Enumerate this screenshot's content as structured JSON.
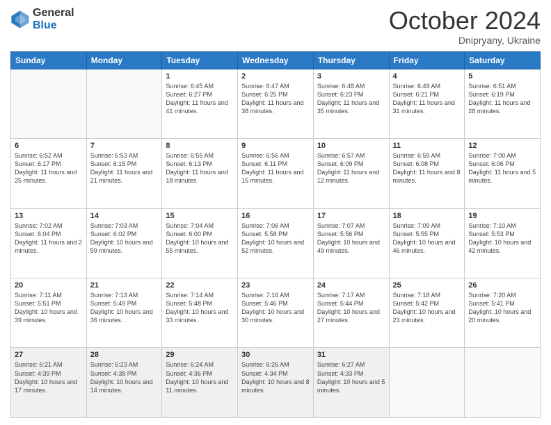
{
  "header": {
    "logo_general": "General",
    "logo_blue": "Blue",
    "month_year": "October 2024",
    "location": "Dnipryany, Ukraine"
  },
  "days_of_week": [
    "Sunday",
    "Monday",
    "Tuesday",
    "Wednesday",
    "Thursday",
    "Friday",
    "Saturday"
  ],
  "weeks": [
    [
      {
        "day": "",
        "sunrise": "",
        "sunset": "",
        "daylight": ""
      },
      {
        "day": "",
        "sunrise": "",
        "sunset": "",
        "daylight": ""
      },
      {
        "day": "1",
        "sunrise": "Sunrise: 6:45 AM",
        "sunset": "Sunset: 6:27 PM",
        "daylight": "Daylight: 11 hours and 41 minutes."
      },
      {
        "day": "2",
        "sunrise": "Sunrise: 6:47 AM",
        "sunset": "Sunset: 6:25 PM",
        "daylight": "Daylight: 11 hours and 38 minutes."
      },
      {
        "day": "3",
        "sunrise": "Sunrise: 6:48 AM",
        "sunset": "Sunset: 6:23 PM",
        "daylight": "Daylight: 11 hours and 35 minutes."
      },
      {
        "day": "4",
        "sunrise": "Sunrise: 6:49 AM",
        "sunset": "Sunset: 6:21 PM",
        "daylight": "Daylight: 11 hours and 31 minutes."
      },
      {
        "day": "5",
        "sunrise": "Sunrise: 6:51 AM",
        "sunset": "Sunset: 6:19 PM",
        "daylight": "Daylight: 11 hours and 28 minutes."
      }
    ],
    [
      {
        "day": "6",
        "sunrise": "Sunrise: 6:52 AM",
        "sunset": "Sunset: 6:17 PM",
        "daylight": "Daylight: 11 hours and 25 minutes."
      },
      {
        "day": "7",
        "sunrise": "Sunrise: 6:53 AM",
        "sunset": "Sunset: 6:15 PM",
        "daylight": "Daylight: 11 hours and 21 minutes."
      },
      {
        "day": "8",
        "sunrise": "Sunrise: 6:55 AM",
        "sunset": "Sunset: 6:13 PM",
        "daylight": "Daylight: 11 hours and 18 minutes."
      },
      {
        "day": "9",
        "sunrise": "Sunrise: 6:56 AM",
        "sunset": "Sunset: 6:11 PM",
        "daylight": "Daylight: 11 hours and 15 minutes."
      },
      {
        "day": "10",
        "sunrise": "Sunrise: 6:57 AM",
        "sunset": "Sunset: 6:09 PM",
        "daylight": "Daylight: 11 hours and 12 minutes."
      },
      {
        "day": "11",
        "sunrise": "Sunrise: 6:59 AM",
        "sunset": "Sunset: 6:08 PM",
        "daylight": "Daylight: 11 hours and 8 minutes."
      },
      {
        "day": "12",
        "sunrise": "Sunrise: 7:00 AM",
        "sunset": "Sunset: 6:06 PM",
        "daylight": "Daylight: 11 hours and 5 minutes."
      }
    ],
    [
      {
        "day": "13",
        "sunrise": "Sunrise: 7:02 AM",
        "sunset": "Sunset: 6:04 PM",
        "daylight": "Daylight: 11 hours and 2 minutes."
      },
      {
        "day": "14",
        "sunrise": "Sunrise: 7:03 AM",
        "sunset": "Sunset: 6:02 PM",
        "daylight": "Daylight: 10 hours and 59 minutes."
      },
      {
        "day": "15",
        "sunrise": "Sunrise: 7:04 AM",
        "sunset": "Sunset: 6:00 PM",
        "daylight": "Daylight: 10 hours and 55 minutes."
      },
      {
        "day": "16",
        "sunrise": "Sunrise: 7:06 AM",
        "sunset": "Sunset: 5:58 PM",
        "daylight": "Daylight: 10 hours and 52 minutes."
      },
      {
        "day": "17",
        "sunrise": "Sunrise: 7:07 AM",
        "sunset": "Sunset: 5:56 PM",
        "daylight": "Daylight: 10 hours and 49 minutes."
      },
      {
        "day": "18",
        "sunrise": "Sunrise: 7:09 AM",
        "sunset": "Sunset: 5:55 PM",
        "daylight": "Daylight: 10 hours and 46 minutes."
      },
      {
        "day": "19",
        "sunrise": "Sunrise: 7:10 AM",
        "sunset": "Sunset: 5:53 PM",
        "daylight": "Daylight: 10 hours and 42 minutes."
      }
    ],
    [
      {
        "day": "20",
        "sunrise": "Sunrise: 7:11 AM",
        "sunset": "Sunset: 5:51 PM",
        "daylight": "Daylight: 10 hours and 39 minutes."
      },
      {
        "day": "21",
        "sunrise": "Sunrise: 7:13 AM",
        "sunset": "Sunset: 5:49 PM",
        "daylight": "Daylight: 10 hours and 36 minutes."
      },
      {
        "day": "22",
        "sunrise": "Sunrise: 7:14 AM",
        "sunset": "Sunset: 5:48 PM",
        "daylight": "Daylight: 10 hours and 33 minutes."
      },
      {
        "day": "23",
        "sunrise": "Sunrise: 7:16 AM",
        "sunset": "Sunset: 5:46 PM",
        "daylight": "Daylight: 10 hours and 30 minutes."
      },
      {
        "day": "24",
        "sunrise": "Sunrise: 7:17 AM",
        "sunset": "Sunset: 5:44 PM",
        "daylight": "Daylight: 10 hours and 27 minutes."
      },
      {
        "day": "25",
        "sunrise": "Sunrise: 7:18 AM",
        "sunset": "Sunset: 5:42 PM",
        "daylight": "Daylight: 10 hours and 23 minutes."
      },
      {
        "day": "26",
        "sunrise": "Sunrise: 7:20 AM",
        "sunset": "Sunset: 5:41 PM",
        "daylight": "Daylight: 10 hours and 20 minutes."
      }
    ],
    [
      {
        "day": "27",
        "sunrise": "Sunrise: 6:21 AM",
        "sunset": "Sunset: 4:39 PM",
        "daylight": "Daylight: 10 hours and 17 minutes."
      },
      {
        "day": "28",
        "sunrise": "Sunrise: 6:23 AM",
        "sunset": "Sunset: 4:38 PM",
        "daylight": "Daylight: 10 hours and 14 minutes."
      },
      {
        "day": "29",
        "sunrise": "Sunrise: 6:24 AM",
        "sunset": "Sunset: 4:36 PM",
        "daylight": "Daylight: 10 hours and 11 minutes."
      },
      {
        "day": "30",
        "sunrise": "Sunrise: 6:26 AM",
        "sunset": "Sunset: 4:34 PM",
        "daylight": "Daylight: 10 hours and 8 minutes."
      },
      {
        "day": "31",
        "sunrise": "Sunrise: 6:27 AM",
        "sunset": "Sunset: 4:33 PM",
        "daylight": "Daylight: 10 hours and 5 minutes."
      },
      {
        "day": "",
        "sunrise": "",
        "sunset": "",
        "daylight": ""
      },
      {
        "day": "",
        "sunrise": "",
        "sunset": "",
        "daylight": ""
      }
    ]
  ]
}
